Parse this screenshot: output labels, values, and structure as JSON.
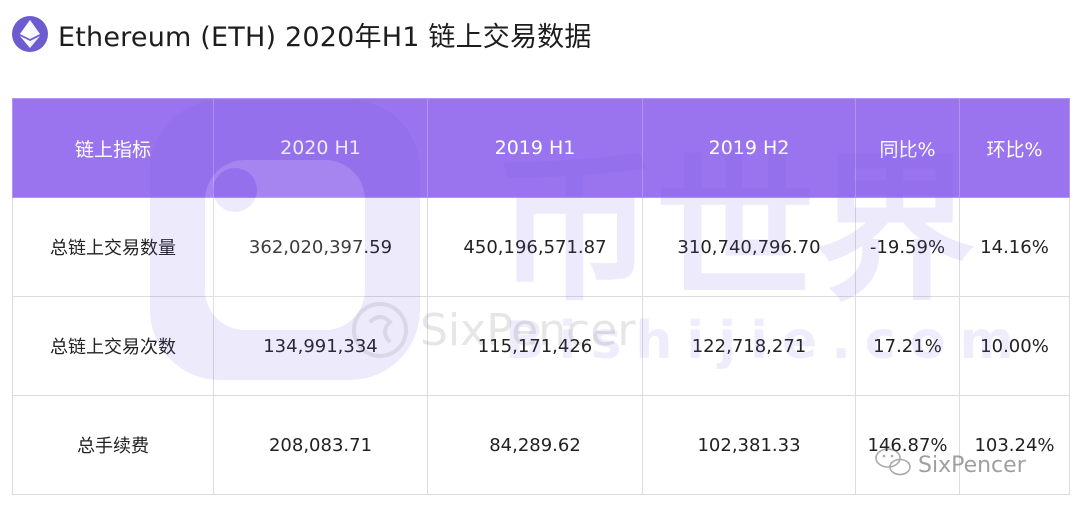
{
  "header": {
    "title": "Ethereum (ETH) 2020年H1 链上交易数据",
    "logo_icon": "ethereum-icon"
  },
  "table": {
    "columns": [
      "链上指标",
      "2020 H1",
      "2019 H1",
      "2019 H2",
      "同比%",
      "环比%"
    ],
    "rows": [
      [
        "总链上交易数量",
        "362,020,397.59",
        "450,196,571.87",
        "310,740,796.70",
        "-19.59%",
        "14.16%"
      ],
      [
        "总链上交易次数",
        "134,991,334",
        "115,171,426",
        "122,718,271",
        "17.21%",
        "10.00%"
      ],
      [
        "总手续费",
        "208,083.71",
        "84,289.62",
        "102,381.33",
        "146.87%",
        "103.24%"
      ]
    ]
  },
  "watermark": {
    "brand_cn": "币世界",
    "brand_en": "Bishijie.com",
    "wechat_label": "SixPencer",
    "sixpencer_faint": "SixPencer"
  },
  "colors": {
    "header_bg": "#9a74ee",
    "logo_bg": "#6d5bd0",
    "watermark": "#6a5be0"
  }
}
